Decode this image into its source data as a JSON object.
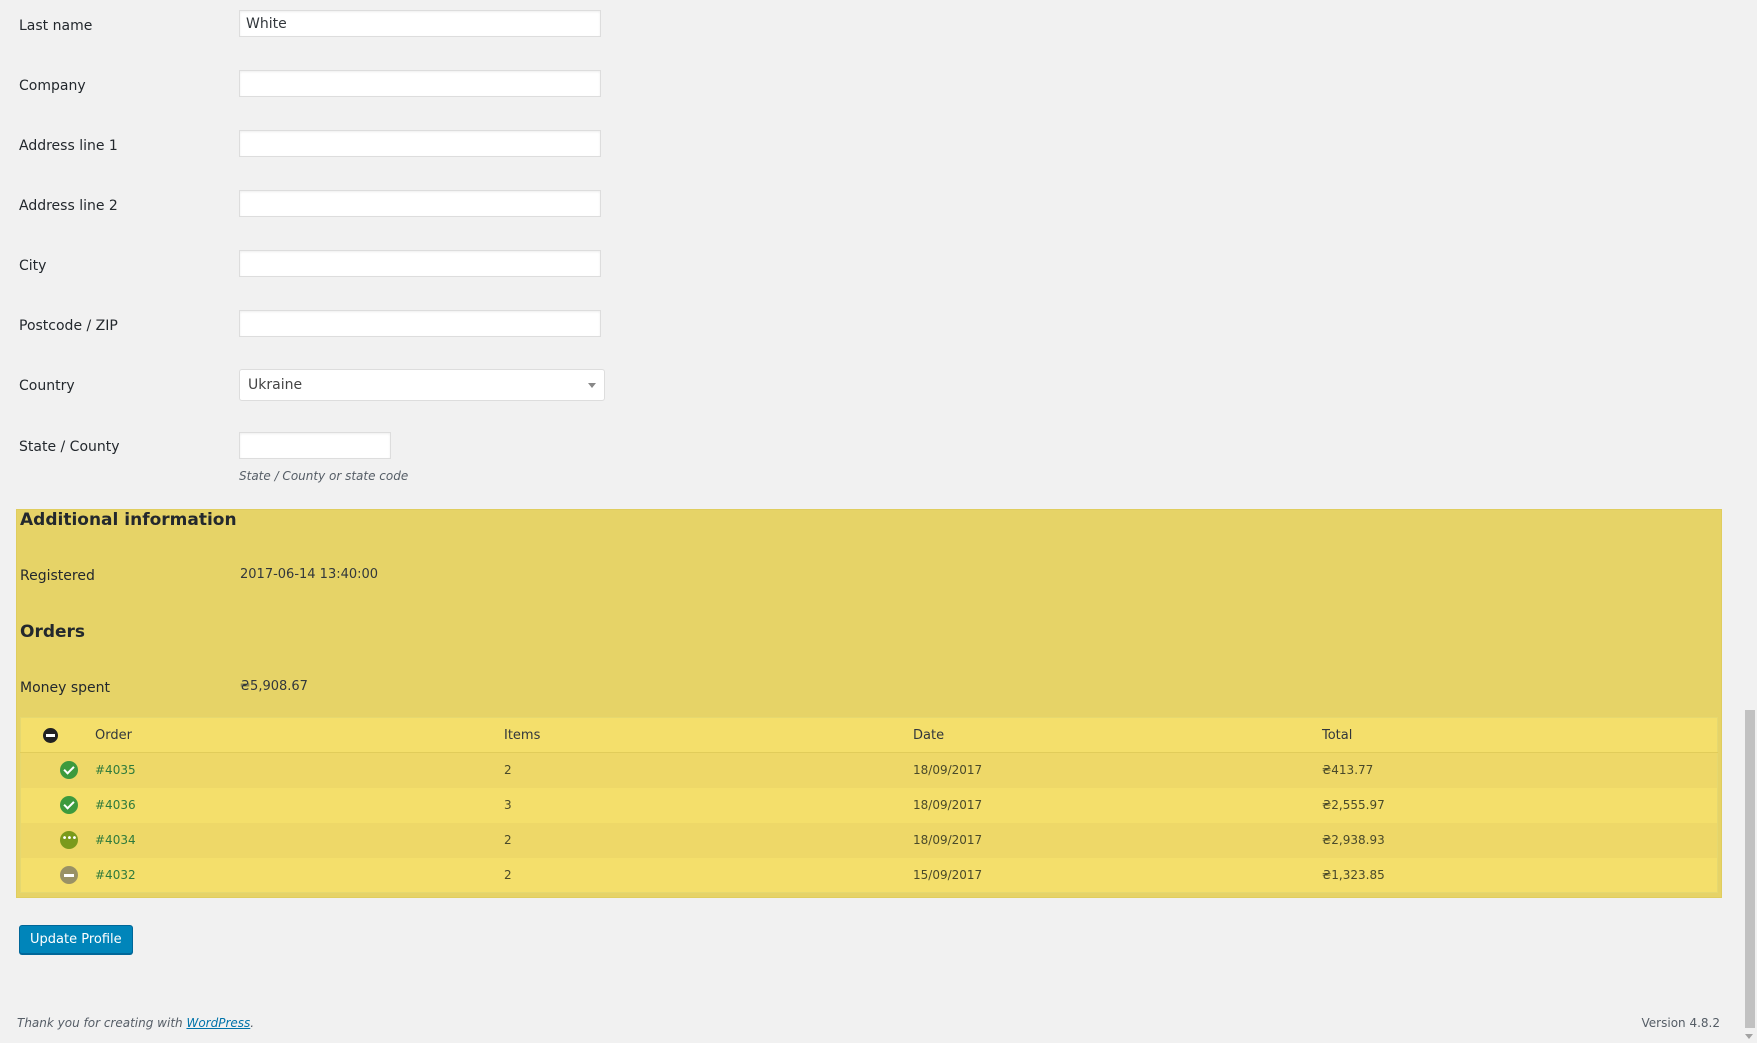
{
  "form": {
    "last_name": {
      "label": "Last name",
      "value": "White"
    },
    "company": {
      "label": "Company",
      "value": ""
    },
    "address_1": {
      "label": "Address line 1",
      "value": ""
    },
    "address_2": {
      "label": "Address line 2",
      "value": ""
    },
    "city": {
      "label": "City",
      "value": ""
    },
    "postcode": {
      "label": "Postcode / ZIP",
      "value": ""
    },
    "country": {
      "label": "Country",
      "value": "Ukraine"
    },
    "state": {
      "label": "State / County",
      "value": "",
      "description": "State / County or state code"
    }
  },
  "additional": {
    "heading": "Additional information",
    "registered_label": "Registered",
    "registered_value": "2017-06-14 13:40:00"
  },
  "orders": {
    "heading": "Orders",
    "money_spent_label": "Money spent",
    "money_spent_value": "₴5,908.67",
    "columns": {
      "order": "Order",
      "items": "Items",
      "date": "Date",
      "total": "Total"
    },
    "rows": [
      {
        "status": "completed",
        "order": "#4035",
        "items": "2",
        "date": "18/09/2017",
        "total": "₴413.77"
      },
      {
        "status": "completed",
        "order": "#4036",
        "items": "3",
        "date": "18/09/2017",
        "total": "₴2,555.97"
      },
      {
        "status": "processing",
        "order": "#4034",
        "items": "2",
        "date": "18/09/2017",
        "total": "₴2,938.93"
      },
      {
        "status": "cancelled",
        "order": "#4032",
        "items": "2",
        "date": "15/09/2017",
        "total": "₴1,323.85"
      }
    ]
  },
  "actions": {
    "update_label": "Update Profile"
  },
  "footer": {
    "thanks_prefix": "Thank you for creating with ",
    "thanks_link": "WordPress",
    "thanks_suffix": ".",
    "version": "Version 4.8.2"
  },
  "colors": {
    "highlight": "#e6d367",
    "primary_button": "#0085ba",
    "completed": "#3d9a3d",
    "processing": "#7a9a1c",
    "cancelled": "#999165"
  }
}
